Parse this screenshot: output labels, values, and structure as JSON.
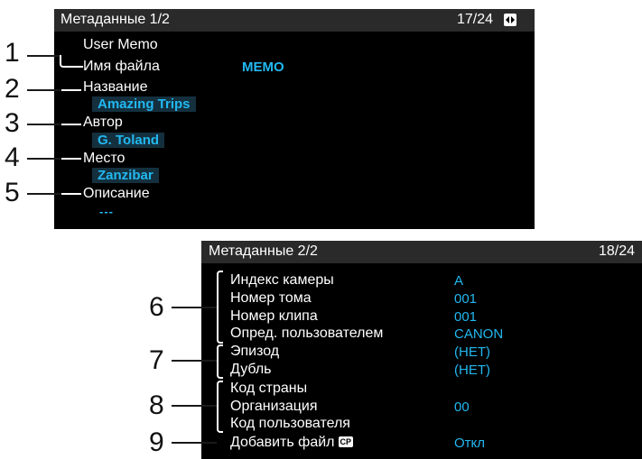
{
  "screen1": {
    "header_title": "Метаданные 1/2",
    "page_counter": "17/24",
    "page_icon": "page-toggle-icon",
    "user_memo_label": "User Memo",
    "rows": [
      {
        "label": "Имя файла",
        "value": "MEMO"
      },
      {
        "label": "Название",
        "value": "Amazing Trips"
      },
      {
        "label": "Автор",
        "value": "G. Toland"
      },
      {
        "label": "Место",
        "value": "Zanzibar"
      },
      {
        "label": "Описание",
        "value": "---"
      }
    ]
  },
  "screen2": {
    "header_title": "Метаданные 2/2",
    "page_counter": "18/24",
    "rows": [
      {
        "label": "Индекс камеры",
        "value": "A"
      },
      {
        "label": "Номер тома",
        "value": "001"
      },
      {
        "label": "Номер клипа",
        "value": "001"
      },
      {
        "label": "Опред. пользователем",
        "value": "CANON"
      },
      {
        "label": "Эпизод",
        "value": "(НЕТ)"
      },
      {
        "label": "Дубль",
        "value": "(НЕТ)"
      },
      {
        "label": "Код страны",
        "value": ""
      },
      {
        "label": "Организация",
        "value": "00"
      },
      {
        "label": "Код пользователя",
        "value": ""
      },
      {
        "label": "Добавить файл",
        "value": "Откл"
      }
    ],
    "add_file_icon_text": "CP"
  },
  "callouts": [
    "1",
    "2",
    "3",
    "4",
    "5",
    "6",
    "7",
    "8",
    "9"
  ],
  "colors": {
    "value": "#22b8f0",
    "screen_bg": "#000000",
    "header_bg": "#2a2a2a"
  }
}
